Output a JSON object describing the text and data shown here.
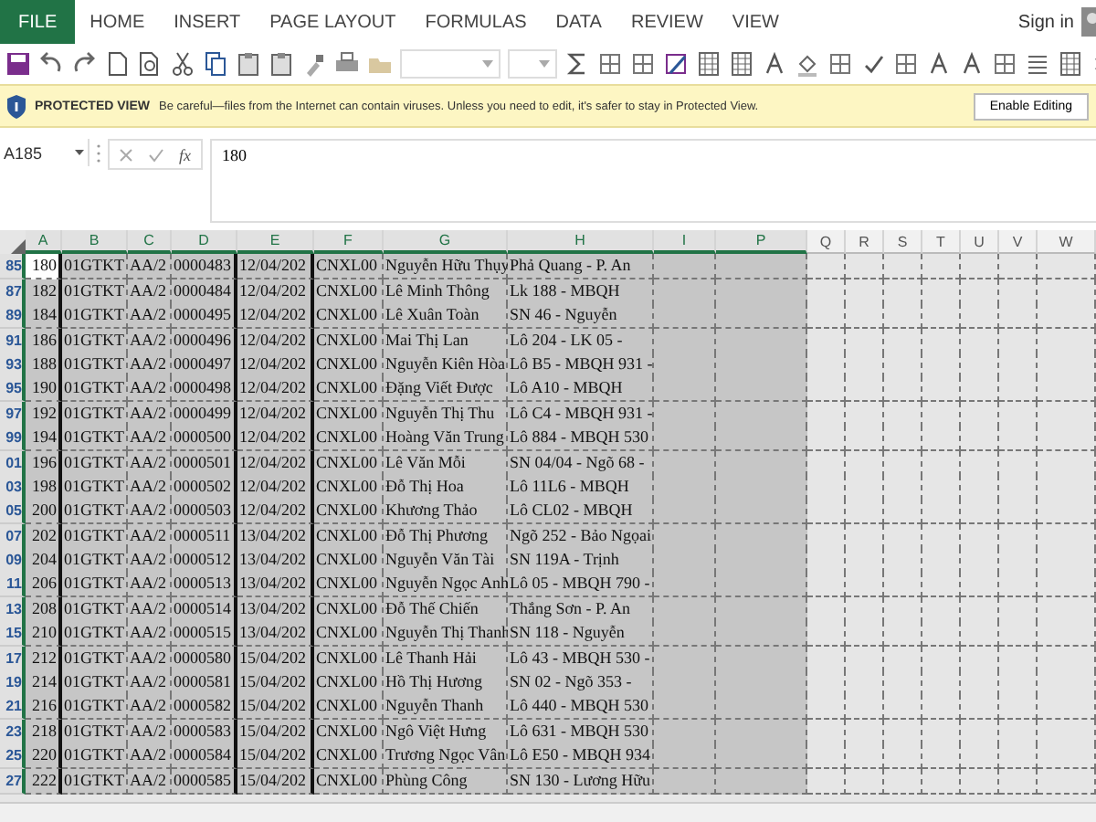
{
  "ribbon": {
    "tabs": [
      {
        "label": "FILE",
        "kind": "file"
      },
      {
        "label": "HOME",
        "kind": "tab"
      },
      {
        "label": "INSERT",
        "kind": "tab"
      },
      {
        "label": "PAGE LAYOUT",
        "kind": "tab"
      },
      {
        "label": "FORMULAS",
        "kind": "tab"
      },
      {
        "label": "DATA",
        "kind": "tab"
      },
      {
        "label": "REVIEW",
        "kind": "tab"
      },
      {
        "label": "VIEW",
        "kind": "tab"
      }
    ],
    "sign_in": "Sign in"
  },
  "protected_view": {
    "title": "PROTECTED VIEW",
    "message": "Be careful—files from the Internet can contain viruses. Unless you need to edit, it's safer to stay in Protected View.",
    "button": "Enable Editing"
  },
  "formula_bar": {
    "name_box": "A185",
    "function_label": "fx",
    "value": "180"
  },
  "sheet": {
    "columns": [
      {
        "label": "A",
        "selected": true
      },
      {
        "label": "B",
        "selected": true
      },
      {
        "label": "C",
        "selected": true
      },
      {
        "label": "D",
        "selected": true
      },
      {
        "label": "E",
        "selected": true
      },
      {
        "label": "F",
        "selected": true
      },
      {
        "label": "G",
        "selected": true
      },
      {
        "label": "H",
        "selected": true
      },
      {
        "label": "I",
        "selected": true
      },
      {
        "label": "P",
        "selected": true
      },
      {
        "label": "Q",
        "selected": false
      },
      {
        "label": "R",
        "selected": false
      },
      {
        "label": "S",
        "selected": false
      },
      {
        "label": "T",
        "selected": false
      },
      {
        "label": "U",
        "selected": false
      },
      {
        "label": "V",
        "selected": false
      },
      {
        "label": "W",
        "selected": false
      }
    ],
    "rows": [
      {
        "header": "85",
        "selected": true,
        "active": true,
        "cells": [
          "180",
          "01GTKT",
          "AA/2",
          "0000483",
          "12/04/202",
          "CNXL00",
          "Nguyễn Hữu Thụy",
          "Phả Quang - P. An"
        ]
      },
      {
        "header": "87",
        "selected": true,
        "active": false,
        "cells": [
          "182",
          "01GTKT",
          "AA/2",
          "0000484",
          "12/04/202",
          "CNXL00",
          "Lê Minh Thông",
          "Lk 188 - MBQH"
        ]
      },
      {
        "header": "89",
        "selected": true,
        "active": false,
        "cells": [
          "184",
          "01GTKT",
          "AA/2",
          "0000495",
          "12/04/202",
          "CNXL00",
          "Lê Xuân Toàn",
          "SN 46 - Nguyễn"
        ]
      },
      {
        "header": "91",
        "selected": true,
        "active": false,
        "cells": [
          "186",
          "01GTKT",
          "AA/2",
          "0000496",
          "12/04/202",
          "CNXL00",
          "Mai Thị Lan",
          "Lô 204 - LK 05 -"
        ]
      },
      {
        "header": "93",
        "selected": true,
        "active": false,
        "cells": [
          "188",
          "01GTKT",
          "AA/2",
          "0000497",
          "12/04/202",
          "CNXL00",
          "Nguyễn Kiên Hòa",
          "Lô B5 - MBQH 931 -"
        ]
      },
      {
        "header": "95",
        "selected": true,
        "active": false,
        "cells": [
          "190",
          "01GTKT",
          "AA/2",
          "0000498",
          "12/04/202",
          "CNXL00",
          "Đặng Viết Được",
          "Lô A10 - MBQH"
        ]
      },
      {
        "header": "97",
        "selected": true,
        "active": false,
        "cells": [
          "192",
          "01GTKT",
          "AA/2",
          "0000499",
          "12/04/202",
          "CNXL00",
          "Nguyễn Thị Thu",
          "Lô C4 - MBQH 931 -"
        ]
      },
      {
        "header": "99",
        "selected": true,
        "active": false,
        "cells": [
          "194",
          "01GTKT",
          "AA/2",
          "0000500",
          "12/04/202",
          "CNXL00",
          "Hoàng Văn Trung",
          "Lô 884 - MBQH 530"
        ]
      },
      {
        "header": "01",
        "selected": true,
        "active": false,
        "cells": [
          "196",
          "01GTKT",
          "AA/2",
          "0000501",
          "12/04/202",
          "CNXL00",
          "Lê Văn Mỗi",
          "SN 04/04 - Ngõ 68 -"
        ]
      },
      {
        "header": "03",
        "selected": true,
        "active": false,
        "cells": [
          "198",
          "01GTKT",
          "AA/2",
          "0000502",
          "12/04/202",
          "CNXL00",
          "Đỗ Thị Hoa",
          "Lô 11L6 - MBQH"
        ]
      },
      {
        "header": "05",
        "selected": true,
        "active": false,
        "cells": [
          "200",
          "01GTKT",
          "AA/2",
          "0000503",
          "12/04/202",
          "CNXL00",
          "Khương Thảo",
          "Lô CL02 - MBQH"
        ]
      },
      {
        "header": "07",
        "selected": true,
        "active": false,
        "cells": [
          "202",
          "01GTKT",
          "AA/2",
          "0000511",
          "13/04/202",
          "CNXL00",
          "Đỗ Thị Phương",
          "Ngõ 252 - Bảo Ngọai"
        ]
      },
      {
        "header": "09",
        "selected": true,
        "active": false,
        "cells": [
          "204",
          "01GTKT",
          "AA/2",
          "0000512",
          "13/04/202",
          "CNXL00",
          "Nguyễn Văn Tài",
          "SN 119A - Trịnh"
        ]
      },
      {
        "header": "11",
        "selected": true,
        "active": false,
        "cells": [
          "206",
          "01GTKT",
          "AA/2",
          "0000513",
          "13/04/202",
          "CNXL00",
          "Nguyễn Ngọc Anh",
          "Lô 05 - MBQH 790 -"
        ]
      },
      {
        "header": "13",
        "selected": true,
        "active": false,
        "cells": [
          "208",
          "01GTKT",
          "AA/2",
          "0000514",
          "13/04/202",
          "CNXL00",
          "Đỗ Thế Chiến",
          "Thắng Sơn - P. An"
        ]
      },
      {
        "header": "15",
        "selected": true,
        "active": false,
        "cells": [
          "210",
          "01GTKT",
          "AA/2",
          "0000515",
          "13/04/202",
          "CNXL00",
          "Nguyễn Thị Thanh",
          "SN 118 - Nguyễn"
        ]
      },
      {
        "header": "17",
        "selected": true,
        "active": false,
        "cells": [
          "212",
          "01GTKT",
          "AA/2",
          "0000580",
          "15/04/202",
          "CNXL00",
          "Lê Thanh Hải",
          "Lô 43 - MBQH 530 -"
        ]
      },
      {
        "header": "19",
        "selected": true,
        "active": false,
        "cells": [
          "214",
          "01GTKT",
          "AA/2",
          "0000581",
          "15/04/202",
          "CNXL00",
          "Hồ Thị Hương",
          "SN 02 - Ngõ 353 -"
        ]
      },
      {
        "header": "21",
        "selected": true,
        "active": false,
        "cells": [
          "216",
          "01GTKT",
          "AA/2",
          "0000582",
          "15/04/202",
          "CNXL00",
          "Nguyễn Thanh",
          "Lô 440 - MBQH 530"
        ]
      },
      {
        "header": "23",
        "selected": true,
        "active": false,
        "cells": [
          "218",
          "01GTKT",
          "AA/2",
          "0000583",
          "15/04/202",
          "CNXL00",
          "Ngô Việt Hưng",
          "Lô 631 - MBQH 530"
        ]
      },
      {
        "header": "25",
        "selected": true,
        "active": false,
        "cells": [
          "220",
          "01GTKT",
          "AA/2",
          "0000584",
          "15/04/202",
          "CNXL00",
          "Trương Ngọc Vân",
          "Lô E50 - MBQH 934"
        ]
      },
      {
        "header": "27",
        "selected": true,
        "active": false,
        "cells": [
          "222",
          "01GTKT",
          "AA/2",
          "0000585",
          "15/04/202",
          "CNXL00",
          "Phùng Công",
          "SN 130 - Lương Hữu"
        ]
      }
    ]
  }
}
